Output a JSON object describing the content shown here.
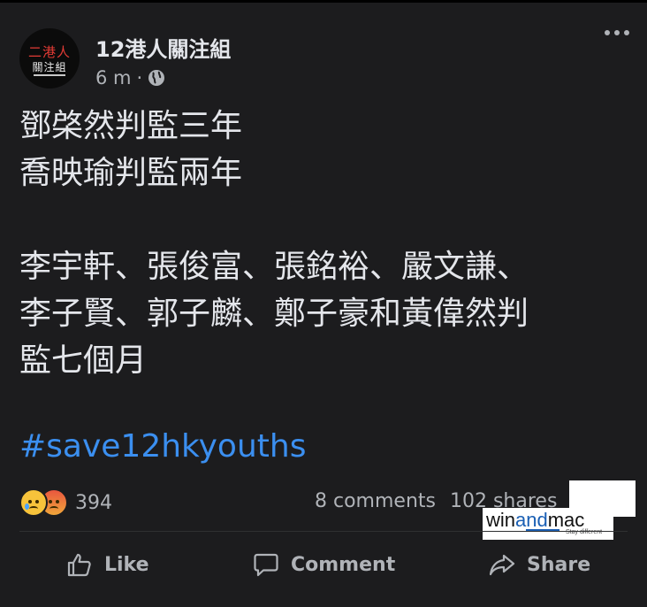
{
  "post": {
    "page_name": "12港人關注組",
    "time": "6 m",
    "separator": "·",
    "privacy_icon": "globe-icon",
    "avatar": {
      "line1": "二港人",
      "line2": "關注組"
    },
    "text": "鄧棨然判監三年\n喬映瑜判監兩年\n\n李宇軒、張俊富、張銘裕、嚴文謙、\n李子賢、郭子麟、鄭子豪和黃偉然判\n監七個月",
    "hashtag": "#save12hkyouths"
  },
  "engagement": {
    "reaction_icons": [
      "sad-reaction-icon",
      "angry-reaction-icon"
    ],
    "reaction_count": "394",
    "comments": "8 comments",
    "shares": "102 shares"
  },
  "watermark": {
    "brand_prefix": "win",
    "brand_mid": "and",
    "brand_suffix": "mac",
    "tagline": "Stay different"
  },
  "actions": {
    "like": "Like",
    "comment": "Comment",
    "share": "Share"
  },
  "colors": {
    "background": "#1c1c1e",
    "text": "#e4e6eb",
    "secondary": "#b0b3b8",
    "link": "#3b8ff0"
  }
}
